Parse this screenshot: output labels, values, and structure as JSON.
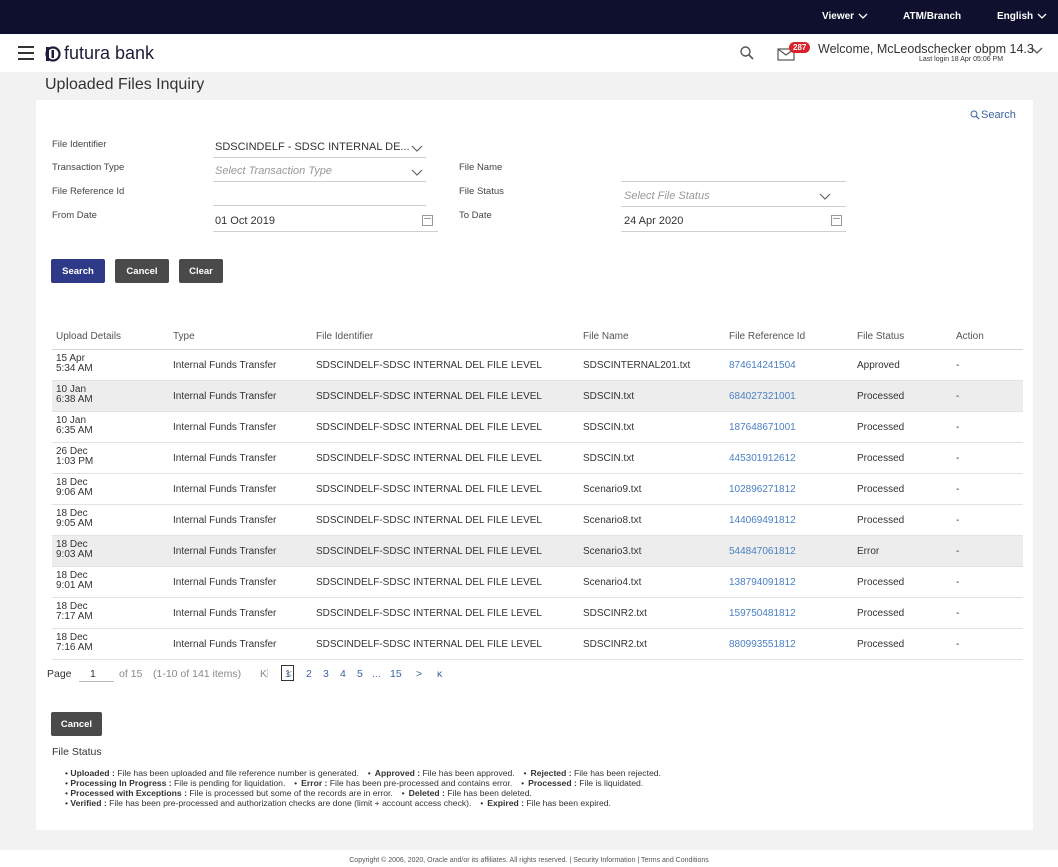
{
  "topbar": {
    "viewer": "Viewer",
    "branch": "ATM/Branch",
    "language": "English"
  },
  "header": {
    "brand": "futura bank",
    "notification_count": "287",
    "welcome": "Welcome, McLeodschecker obpm 14.3",
    "last_login": "Last login 18 Apr 05:06 PM"
  },
  "page": {
    "title": "Uploaded Files Inquiry"
  },
  "search_link": "Search",
  "form": {
    "file_identifier_label": "File Identifier",
    "file_identifier_value": "SDSCINDELF - SDSC INTERNAL DE...",
    "transaction_type_label": "Transaction Type",
    "transaction_type_placeholder": "Select Transaction Type",
    "file_name_label": "File Name",
    "file_reference_label": "File Reference Id",
    "file_status_label": "File Status",
    "file_status_placeholder": "Select File Status",
    "from_date_label": "From Date",
    "from_date_value": "01 Oct 2019",
    "to_date_label": "To Date",
    "to_date_value": "24 Apr 2020"
  },
  "buttons": {
    "search": "Search",
    "cancel": "Cancel",
    "clear": "Clear",
    "bottom_cancel": "Cancel"
  },
  "table": {
    "headers": [
      "Upload Details",
      "Type",
      "File Identifier",
      "File Name",
      "File Reference Id",
      "File Status",
      "Action"
    ],
    "rows": [
      {
        "date": "15 Apr",
        "time": "5:34 AM",
        "type": "Internal Funds Transfer",
        "identifier": "SDSCINDELF-SDSC INTERNAL DEL FILE LEVEL",
        "name": "SDSCINTERNAL201.txt",
        "ref": "874614241504",
        "status": "Approved",
        "action": "-"
      },
      {
        "date": "10 Jan",
        "time": "6:38 AM",
        "type": "Internal Funds Transfer",
        "identifier": "SDSCINDELF-SDSC INTERNAL DEL FILE LEVEL",
        "name": "SDSCIN.txt",
        "ref": "684027321001",
        "status": "Processed",
        "action": "-"
      },
      {
        "date": "10 Jan",
        "time": "6:35 AM",
        "type": "Internal Funds Transfer",
        "identifier": "SDSCINDELF-SDSC INTERNAL DEL FILE LEVEL",
        "name": "SDSCIN.txt",
        "ref": "187648671001",
        "status": "Processed",
        "action": "-"
      },
      {
        "date": "26 Dec",
        "time": "1:03 PM",
        "type": "Internal Funds Transfer",
        "identifier": "SDSCINDELF-SDSC INTERNAL DEL FILE LEVEL",
        "name": "SDSCIN.txt",
        "ref": "445301912612",
        "status": "Processed",
        "action": "-"
      },
      {
        "date": "18 Dec",
        "time": "9:06 AM",
        "type": "Internal Funds Transfer",
        "identifier": "SDSCINDELF-SDSC INTERNAL DEL FILE LEVEL",
        "name": "Scenario9.txt",
        "ref": "102896271812",
        "status": "Processed",
        "action": "-"
      },
      {
        "date": "18 Dec",
        "time": "9:05 AM",
        "type": "Internal Funds Transfer",
        "identifier": "SDSCINDELF-SDSC INTERNAL DEL FILE LEVEL",
        "name": "Scenario8.txt",
        "ref": "144069491812",
        "status": "Processed",
        "action": "-"
      },
      {
        "date": "18 Dec",
        "time": "9:03 AM",
        "type": "Internal Funds Transfer",
        "identifier": "SDSCINDELF-SDSC INTERNAL DEL FILE LEVEL",
        "name": "Scenario3.txt",
        "ref": "544847061812",
        "status": "Error",
        "action": "-"
      },
      {
        "date": "18 Dec",
        "time": "9:01 AM",
        "type": "Internal Funds Transfer",
        "identifier": "SDSCINDELF-SDSC INTERNAL DEL FILE LEVEL",
        "name": "Scenario4.txt",
        "ref": "138794091812",
        "status": "Processed",
        "action": "-"
      },
      {
        "date": "18 Dec",
        "time": "7:17 AM",
        "type": "Internal Funds Transfer",
        "identifier": "SDSCINDELF-SDSC INTERNAL DEL FILE LEVEL",
        "name": "SDSCINR2.txt",
        "ref": "159750481812",
        "status": "Processed",
        "action": "-"
      },
      {
        "date": "18 Dec",
        "time": "7:16 AM",
        "type": "Internal Funds Transfer",
        "identifier": "SDSCINDELF-SDSC INTERNAL DEL FILE LEVEL",
        "name": "SDSCINR2.txt",
        "ref": "880993551812",
        "status": "Processed",
        "action": "-"
      }
    ]
  },
  "pagination": {
    "page_label": "Page",
    "current_page": "1",
    "of_label": "of 15",
    "items_label": "(1-10 of 141 items)",
    "first": "K",
    "prev": "<",
    "pages": [
      "1",
      "2",
      "3",
      "4",
      "5"
    ],
    "ellipsis": "...",
    "last_page": "15",
    "next": ">",
    "last": "κ"
  },
  "file_status_section": {
    "title": "File Status",
    "line1": [
      {
        "term": "Uploaded :",
        "desc": " File has been uploaded and file reference number is generated."
      },
      {
        "term": "Approved :",
        "desc": " File has been approved."
      },
      {
        "term": "Rejected :",
        "desc": " File has been rejected."
      }
    ],
    "line2": [
      {
        "term": "Processing In Progress :",
        "desc": " File is pending for liquidation."
      },
      {
        "term": "Error :",
        "desc": " File has been pre-processed and contains error."
      },
      {
        "term": "Processed :",
        "desc": " File is liquidated."
      }
    ],
    "line3": [
      {
        "term": "Processed with Exceptions :",
        "desc": " File is processed but some of the records are in error."
      },
      {
        "term": "Deleted :",
        "desc": " File has been deleted."
      }
    ],
    "line4": [
      {
        "term": "Verified :",
        "desc": " File has been pre-processed and authorization checks are done (limit + account access check)."
      },
      {
        "term": "Expired :",
        "desc": " File has been expired."
      }
    ]
  },
  "footer": "Copyright © 2006, 2020, Oracle and/or its affiliates. All rights reserved. | Security Information | Terms and Conditions"
}
